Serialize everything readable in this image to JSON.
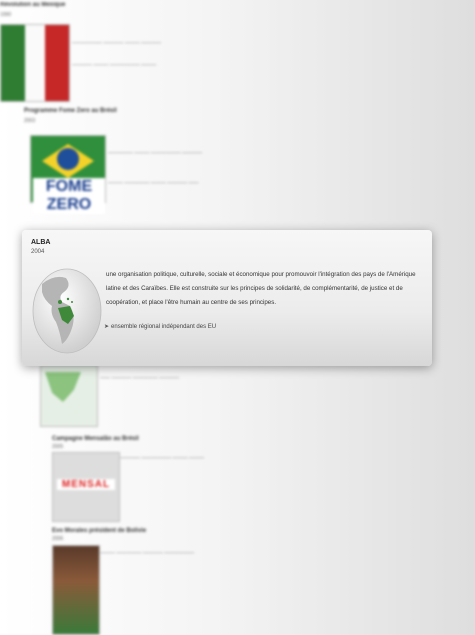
{
  "background": {
    "entries": [
      {
        "heading": "Révolution au Mexique",
        "year": "1990"
      },
      {
        "heading": "Programme Fome Zero au Brésil",
        "year": "2003"
      },
      {
        "heading": "Campagne Mensalão au Brésil",
        "year": "2005"
      },
      {
        "heading": "Evo Morales président de Bolivie",
        "year": "2006"
      }
    ],
    "fome_zero_logo_text": "FOME ZERO",
    "mensal_text": "MENSAL"
  },
  "card": {
    "title": "ALBA",
    "year": "2004",
    "description": "une organisation politique, culturelle, sociale et économique pour promouvoir l'intégration des pays de l'Amérique latine et des Caraïbes. Elle est construite sur les principes de solidarité, de complémentarité, de justice et de coopération, et place l'être humain au centre de ses principes.",
    "link_label": "ensemble régional indépendant des EU",
    "link_icon": "arrow-right-icon"
  },
  "colors": {
    "highlight_land": "#3e8a3a",
    "ocean": "#eeeeee"
  }
}
